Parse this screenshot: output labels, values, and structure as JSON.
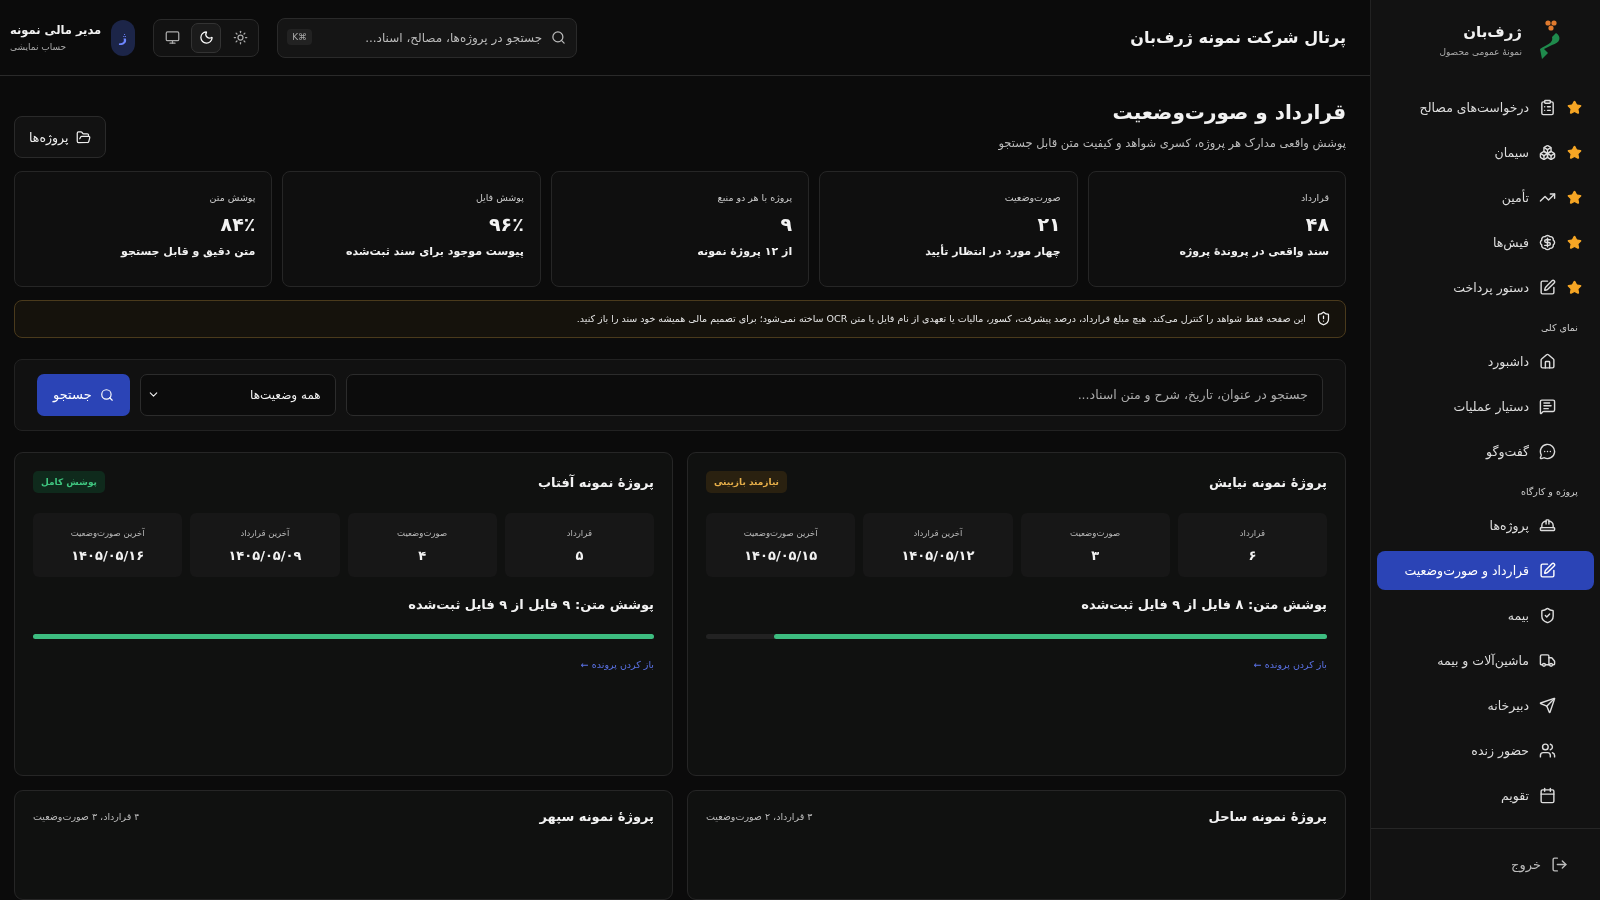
{
  "brand": {
    "name": "ژرف‌بان",
    "tagline": "نمونهٔ عمومی محصول"
  },
  "sidebar": {
    "sections": [
      {
        "items": [
          {
            "label": "درخواست‌های مصالح",
            "starred": true,
            "selected": false
          },
          {
            "label": "سیمان",
            "starred": true,
            "selected": false
          },
          {
            "label": "تأمین",
            "starred": true,
            "selected": false
          },
          {
            "label": "فیش‌ها",
            "starred": true,
            "selected": false
          },
          {
            "label": "دستور پرداخت",
            "starred": true,
            "selected": false
          }
        ]
      },
      {
        "title": "نمای کلی",
        "items": [
          {
            "label": "داشبورد",
            "starred": false,
            "selected": false
          },
          {
            "label": "دستیار عملیات",
            "starred": false,
            "selected": false
          },
          {
            "label": "گفت‌وگو",
            "starred": false,
            "selected": false
          }
        ]
      },
      {
        "title": "پروژه و کارگاه",
        "items": [
          {
            "label": "پروژه‌ها",
            "starred": false,
            "selected": false
          },
          {
            "label": "قرارداد و صورت‌وضعیت",
            "starred": false,
            "selected": true
          },
          {
            "label": "بیمه",
            "starred": false,
            "selected": false
          },
          {
            "label": "ماشین‌آلات و بیمه",
            "starred": false,
            "selected": false
          },
          {
            "label": "دبیرخانه",
            "starred": false,
            "selected": false
          },
          {
            "label": "حضور زنده",
            "starred": false,
            "selected": false
          },
          {
            "label": "تقویم",
            "starred": false,
            "selected": false
          }
        ]
      }
    ],
    "logout": "خروج"
  },
  "header": {
    "title": "پرتال شرکت نمونه ژرف‌بان",
    "search": {
      "placeholder": "جستجو در پروژه‌ها، مصالح، اسناد...",
      "shortcut": "K⌘"
    },
    "theme_options": [
      {
        "kind": "light",
        "selected": false
      },
      {
        "kind": "dark",
        "selected": true
      },
      {
        "kind": "system",
        "selected": false
      }
    ],
    "user": {
      "initial": "ژ",
      "name": "مدیر مالی نمونه",
      "role": "حساب نمایشی"
    }
  },
  "page": {
    "title": "قرارداد و صورت‌وضعیت",
    "subtitle": "پوشش واقعی مدارک هر پروژه، کسری شواهد و کیفیت متن قابل جستجو",
    "projects_button": "پروژه‌ها"
  },
  "stats": [
    {
      "label": "قرارداد",
      "value": "۴۸",
      "note": "سند واقعی در پروندهٔ پروژه"
    },
    {
      "label": "صورت‌وضعیت",
      "value": "۲۱",
      "note": "چهار مورد در انتظار تأیید"
    },
    {
      "label": "پروژه با هر دو منبع",
      "value": "۹",
      "note": "از ۱۲ پروژهٔ نمونه"
    },
    {
      "label": "پوشش فایل",
      "value": "۹۶٪",
      "note": "پیوست موجود برای سند ثبت‌شده"
    },
    {
      "label": "پوشش متن",
      "value": "۸۴٪",
      "note": "متن دقیق و قابل جستجو"
    }
  ],
  "notice": "این صفحه فقط شواهد را کنترل می‌کند. هیچ مبلغ قرارداد، درصد پیشرفت، کسور، مالیات یا تعهدی از نام فایل یا متن OCR ساخته نمی‌شود؛ برای تصمیم مالی همیشه خود سند را باز کنید.",
  "filters": {
    "search_placeholder": "جستجو در عنوان، تاریخ، شرح و متن اسناد...",
    "status": "همه وضعیت‌ها",
    "button": "جستجو"
  },
  "projects": [
    {
      "title": "پروژهٔ نمونه نیایش",
      "badge": {
        "label": "نیازمند بازبینی",
        "kind": "review"
      },
      "metrics": [
        {
          "label": "قرارداد",
          "value": "۶"
        },
        {
          "label": "صورت‌وضعیت",
          "value": "۳"
        },
        {
          "label": "آخرین قرارداد",
          "value": "۱۴۰۵/۰۵/۱۲"
        },
        {
          "label": "آخرین صورت‌وضعیت",
          "value": "۱۴۰۵/۰۵/۱۵"
        }
      ],
      "coverage": "پوشش متن: ۸ فایل از ۹ فایل ثبت‌شده",
      "level": 0.89,
      "link": "باز کردن پرونده ←"
    },
    {
      "title": "پروژهٔ نمونه آفتاب",
      "badge": {
        "label": "پوشش کامل",
        "kind": "complete"
      },
      "metrics": [
        {
          "label": "قرارداد",
          "value": "۵"
        },
        {
          "label": "صورت‌وضعیت",
          "value": "۴"
        },
        {
          "label": "آخرین قرارداد",
          "value": "۱۴۰۵/۰۵/۰۹"
        },
        {
          "label": "آخرین صورت‌وضعیت",
          "value": "۱۴۰۵/۰۵/۱۶"
        }
      ],
      "coverage": "پوشش متن: ۹ فایل از ۹ فایل ثبت‌شده",
      "level": 1,
      "link": "باز کردن پرونده ←"
    },
    {
      "title": "پروژهٔ نمونه ساحل",
      "summary": "۳ قرارداد، ۲ صورت‌وضعیت"
    },
    {
      "title": "پروژهٔ نمونه سپهر",
      "summary": "۴ قرارداد، ۳ صورت‌وضعیت"
    }
  ]
}
